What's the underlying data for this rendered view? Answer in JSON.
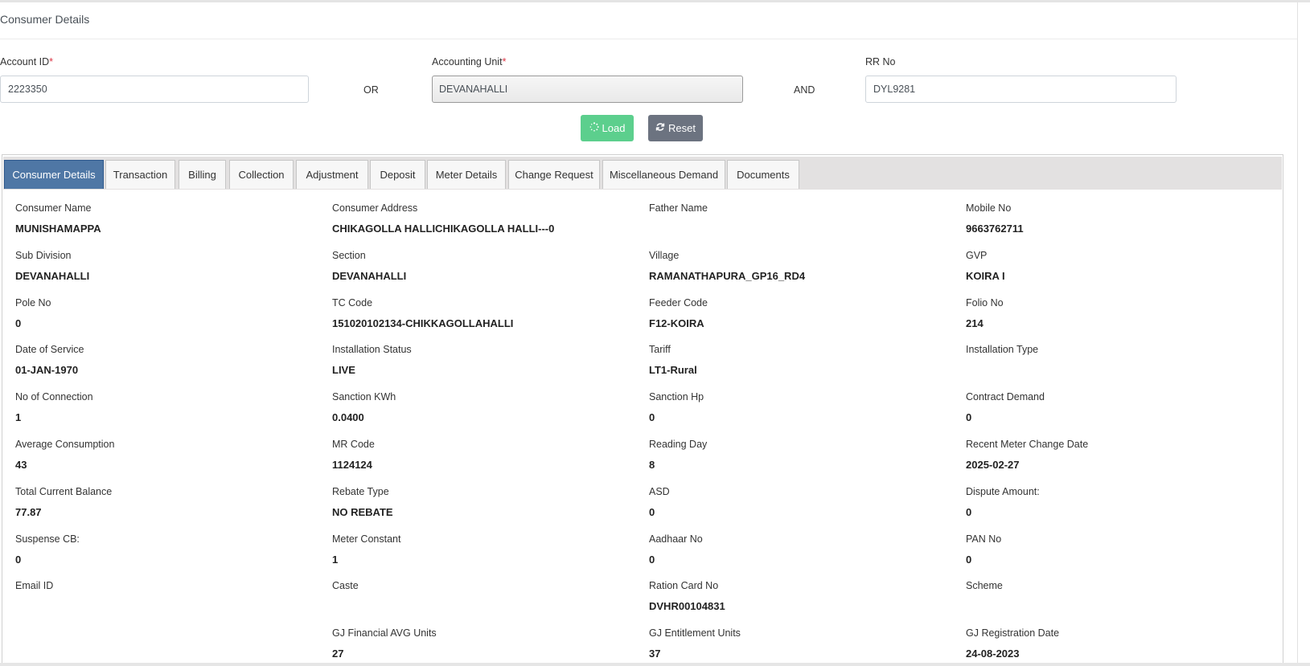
{
  "card": {
    "title": "Consumer Details"
  },
  "form": {
    "account_id": {
      "label": "Account ID",
      "required_mark": "*",
      "value": "2223350"
    },
    "or_text": "OR",
    "accounting_unit": {
      "label": "Accounting Unit",
      "required_mark": "*",
      "value": "DEVANAHALLI"
    },
    "and_text": "AND",
    "rr_no": {
      "label": "RR No",
      "value": "DYL9281"
    }
  },
  "buttons": {
    "load": {
      "label": "Load",
      "icon": "spinner-icon"
    },
    "reset": {
      "label": "Reset",
      "icon": "refresh-icon"
    }
  },
  "colors": {
    "load_button": "#5ccf8d",
    "reset_button": "#6c7380",
    "active_tab": "#4f77a5",
    "required_mark": "#dc3545"
  },
  "tabs": [
    {
      "label": "Consumer Details",
      "active": true
    },
    {
      "label": "Transaction"
    },
    {
      "label": "Billing"
    },
    {
      "label": "Collection"
    },
    {
      "label": "Adjustment"
    },
    {
      "label": "Deposit"
    },
    {
      "label": "Meter Details"
    },
    {
      "label": "Change Request"
    },
    {
      "label": "Miscellaneous Demand"
    },
    {
      "label": "Documents"
    }
  ],
  "details": [
    [
      {
        "label": "Consumer Name",
        "value": "MUNISHAMAPPA"
      },
      {
        "label": "Consumer Address",
        "value": "CHIKAGOLLA HALLICHIKAGOLLA HALLI---0"
      },
      {
        "label": "Father Name",
        "value": ""
      },
      {
        "label": "Mobile No",
        "value": "9663762711"
      }
    ],
    [
      {
        "label": "Sub Division",
        "value": "DEVANAHALLI"
      },
      {
        "label": "Section",
        "value": "DEVANAHALLI"
      },
      {
        "label": "Village",
        "value": "RAMANATHAPURA_GP16_RD4"
      },
      {
        "label": "GVP",
        "value": "KOIRA I"
      }
    ],
    [
      {
        "label": "Pole No",
        "value": "0"
      },
      {
        "label": "TC Code",
        "value": "151020102134-CHIKKAGOLLAHALLI"
      },
      {
        "label": "Feeder Code",
        "value": "F12-KOIRA"
      },
      {
        "label": "Folio No",
        "value": "214"
      }
    ],
    [
      {
        "label": "Date of Service",
        "value": "01-JAN-1970"
      },
      {
        "label": "Installation Status",
        "value": "LIVE"
      },
      {
        "label": "Tariff",
        "value": "LT1-Rural"
      },
      {
        "label": "Installation Type",
        "value": ""
      }
    ],
    [
      {
        "label": "No of Connection",
        "value": "1"
      },
      {
        "label": "Sanction KWh",
        "value": "0.0400"
      },
      {
        "label": "Sanction Hp",
        "value": "0"
      },
      {
        "label": "Contract Demand",
        "value": "0"
      }
    ],
    [
      {
        "label": "Average Consumption",
        "value": "43"
      },
      {
        "label": "MR Code",
        "value": "1124124"
      },
      {
        "label": "Reading Day",
        "value": "8"
      },
      {
        "label": "Recent Meter Change Date",
        "value": "2025-02-27"
      }
    ],
    [
      {
        "label": "Total Current Balance",
        "value": "77.87"
      },
      {
        "label": "Rebate Type",
        "value": "NO REBATE"
      },
      {
        "label": "ASD",
        "value": "0"
      },
      {
        "label": "Dispute Amount:",
        "value": "0"
      }
    ],
    [
      {
        "label": "Suspense CB:",
        "value": "0"
      },
      {
        "label": "Meter Constant",
        "value": "1"
      },
      {
        "label": "Aadhaar No",
        "value": "0"
      },
      {
        "label": "PAN No",
        "value": "0"
      }
    ],
    [
      {
        "label": "Email ID",
        "value": ""
      },
      {
        "label": "Caste",
        "value": ""
      },
      {
        "label": "Ration Card No",
        "value": "DVHR00104831"
      },
      {
        "label": "Scheme",
        "value": ""
      }
    ],
    [
      null,
      {
        "label": "GJ Financial AVG Units",
        "value": "27"
      },
      {
        "label": "GJ Entitlement Units",
        "value": "37"
      },
      {
        "label": "GJ Registration Date",
        "value": "24-08-2023"
      }
    ]
  ]
}
